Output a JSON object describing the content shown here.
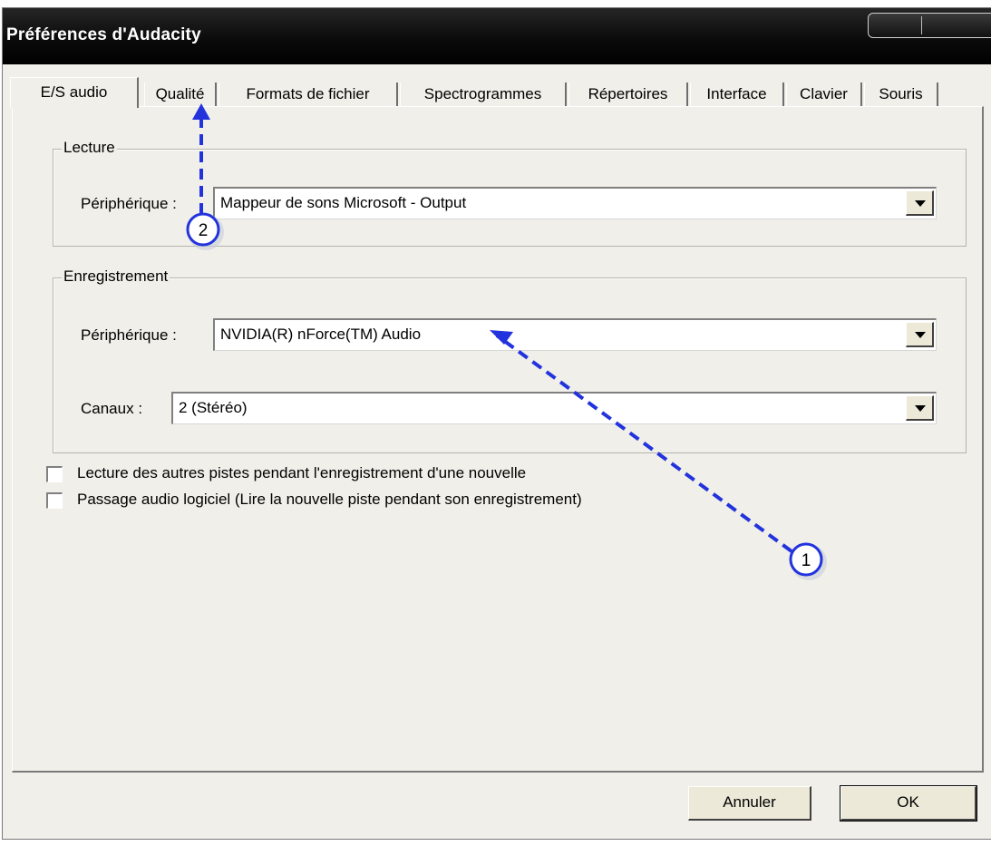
{
  "window": {
    "title": "Préférences d'Audacity"
  },
  "tabs": [
    {
      "label": "E/S audio",
      "active": true
    },
    {
      "label": "Qualité"
    },
    {
      "label": "Formats de fichier"
    },
    {
      "label": "Spectrogrammes"
    },
    {
      "label": "Répertoires"
    },
    {
      "label": "Interface"
    },
    {
      "label": "Clavier"
    },
    {
      "label": "Souris"
    }
  ],
  "playback": {
    "legend": "Lecture",
    "device_label": "Périphérique :",
    "device_value": "Mappeur de sons Microsoft - Output"
  },
  "recording": {
    "legend": "Enregistrement",
    "device_label": "Périphérique :",
    "device_value": "NVIDIA(R) nForce(TM) Audio",
    "channels_label": "Canaux :",
    "channels_value": "2 (Stéréo)"
  },
  "options": [
    {
      "label": "Lecture des autres pistes pendant l'enregistrement d'une nouvelle",
      "checked": false
    },
    {
      "label": "Passage audio logiciel (Lire la nouvelle piste pendant son enregistrement)",
      "checked": false
    }
  ],
  "buttons": {
    "cancel": "Annuler",
    "ok": "OK"
  },
  "annotations": [
    {
      "number": "1",
      "color": "#2233dd"
    },
    {
      "number": "2",
      "color": "#2233dd"
    }
  ]
}
